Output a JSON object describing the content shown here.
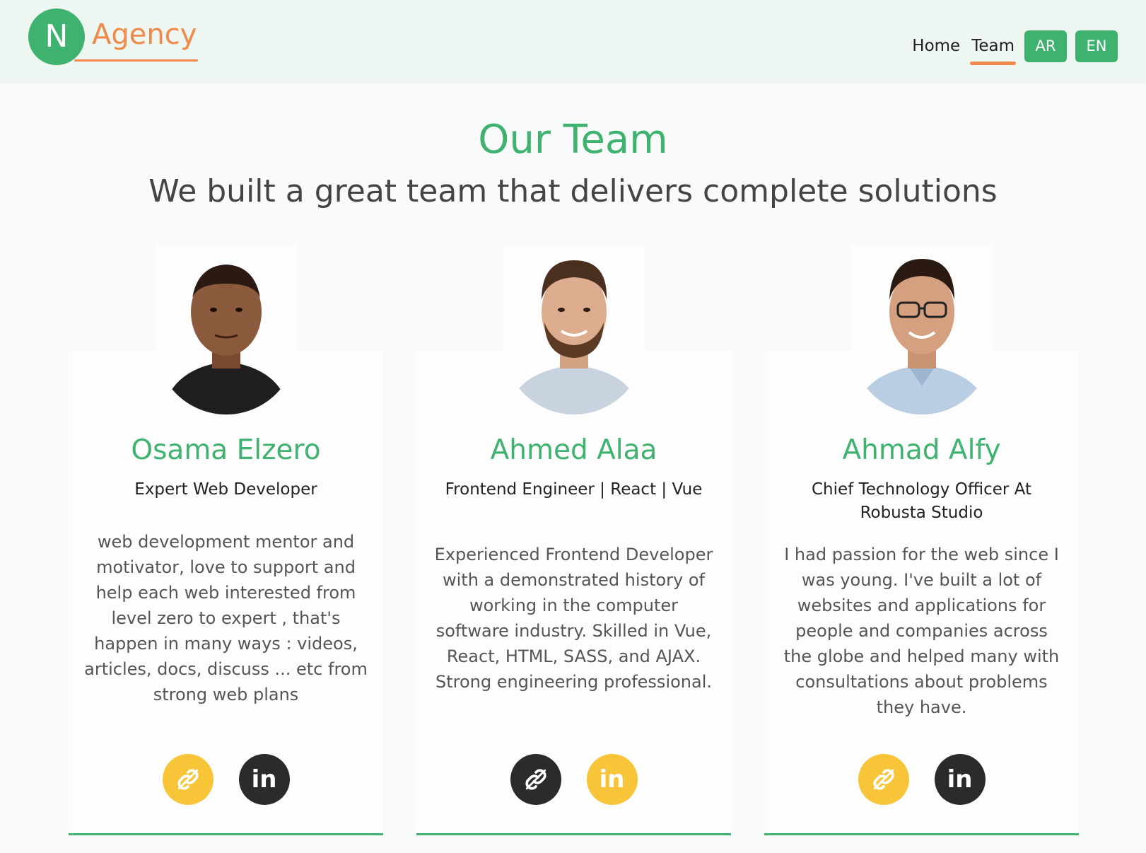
{
  "brand": {
    "letter": "N",
    "name": "Agency"
  },
  "nav": {
    "home": "Home",
    "team": "Team",
    "lang_ar": "AR",
    "lang_en": "EN"
  },
  "hero": {
    "title": "Our Team",
    "subtitle": "We built a great team that delivers complete solutions"
  },
  "members": [
    {
      "name": "Osama Elzero",
      "role": "Expert Web Developer",
      "bio": "web development mentor and motivator, love to support and help each web interested from level zero to expert , that's happen in many ways : videos, articles, docs, discuss ... etc from strong web plans",
      "link_icon": "link-icon",
      "linkedin_label": "in"
    },
    {
      "name": "Ahmed Alaa",
      "role": "Frontend Engineer | React | Vue",
      "bio": "Experienced Frontend Developer with a demonstrated history of working in the computer software industry. Skilled in Vue, React, HTML, SASS, and AJAX. Strong engineering professional.",
      "link_icon": "link-icon",
      "linkedin_label": "in"
    },
    {
      "name": "Ahmad Alfy",
      "role": "Chief Technology Officer At Robusta Studio",
      "bio": "I had passion for the web since I was young. I've built a lot of websites and applications for people and companies across the globe and helped many with consultations about problems they have.",
      "link_icon": "link-icon",
      "linkedin_label": "in"
    }
  ],
  "colors": {
    "primary": "#3fb26f",
    "accent": "#ef8a4a",
    "yellow": "#f7c537",
    "dark": "#2b2b2b"
  }
}
